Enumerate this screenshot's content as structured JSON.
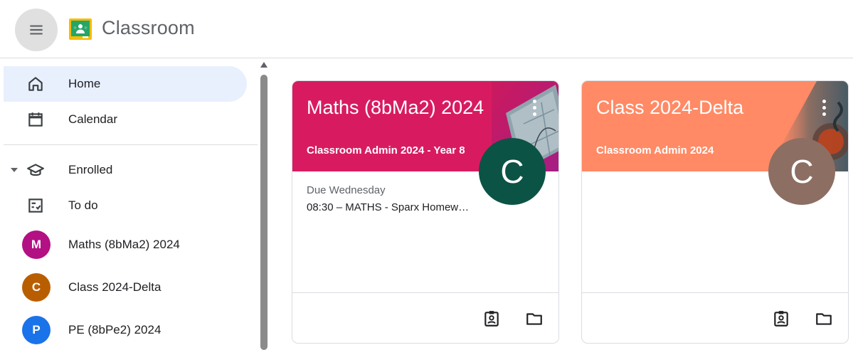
{
  "header": {
    "app_title": "Classroom",
    "menu_icon": "hamburger-menu-icon",
    "logo_icon": "google-classroom-logo"
  },
  "sidebar": {
    "items": [
      {
        "label": "Home",
        "icon": "home-icon",
        "active": true
      },
      {
        "label": "Calendar",
        "icon": "calendar-icon"
      },
      {
        "label": "Enrolled",
        "icon": "graduation-cap-icon",
        "expanded": true
      },
      {
        "label": "To do",
        "icon": "todo-list-icon"
      },
      {
        "label": "Maths (8bMa2) 2024",
        "avatar": "M",
        "avatar_color": "#b31083"
      },
      {
        "label": "Class 2024-Delta",
        "avatar": "C",
        "avatar_color": "#b95e00"
      },
      {
        "label": "PE (8bPe2) 2024",
        "avatar": "P",
        "avatar_color": "#1a73e8"
      }
    ]
  },
  "cards": [
    {
      "title": "Maths (8bMa2) 2024",
      "subtitle": "Classroom Admin 2024 - Year 8",
      "avatar": "C",
      "avatar_color": "#0b5345",
      "header_color": "#d81b60",
      "due_label": "Due Wednesday",
      "due_item": "08:30 – MATHS - Sparx Homew…"
    },
    {
      "title": "Class 2024-Delta",
      "subtitle": "Classroom Admin 2024",
      "avatar": "C",
      "avatar_color": "#8d6e63",
      "header_color": "#ff8a65",
      "due_label": "",
      "due_item": ""
    }
  ]
}
